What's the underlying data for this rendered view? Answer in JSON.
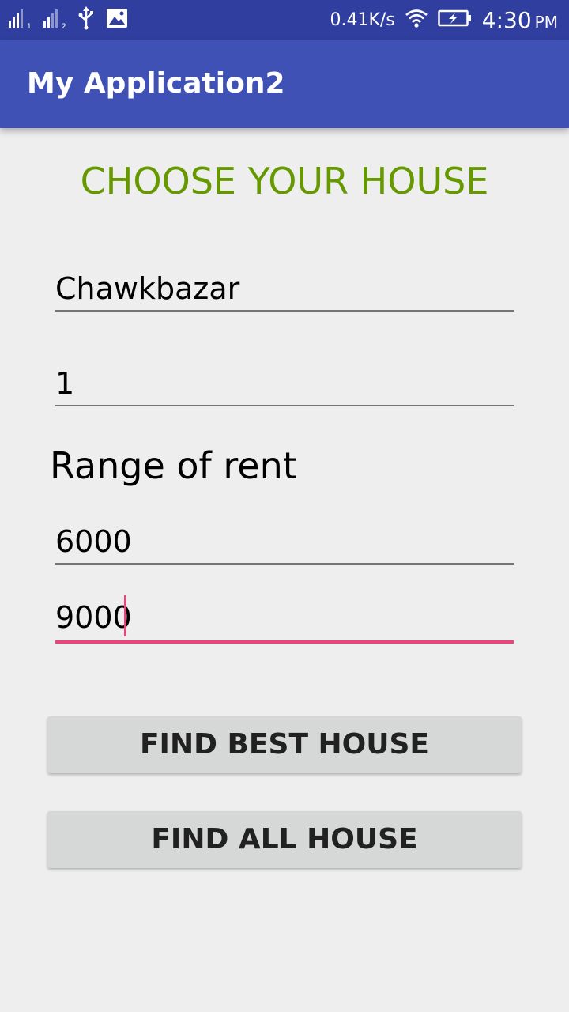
{
  "status_bar": {
    "network_speed": "0.41K/s",
    "time": "4:30",
    "am_pm": "PM",
    "icons": [
      "signal-sim1-icon",
      "signal-sim2-icon",
      "usb-icon",
      "image-icon",
      "wifi-icon",
      "battery-charging-icon"
    ],
    "sim1_label": "1",
    "sim2_label": "2"
  },
  "app_bar": {
    "title": "My Application2"
  },
  "main": {
    "heading": "CHOOSE YOUR HOUSE",
    "location_value": "Chawkbazar",
    "rooms_value": "1",
    "rent_label": "Range of rent",
    "rent_min_value": "6000",
    "rent_max_value": "9000",
    "find_best_label": "FIND BEST HOUSE",
    "find_all_label": "FIND ALL HOUSE"
  },
  "colors": {
    "status_bar": "#303f9f",
    "app_bar": "#3f51b5",
    "heading": "#669900",
    "accent": "#e8467c",
    "button": "#d6d7d7"
  }
}
